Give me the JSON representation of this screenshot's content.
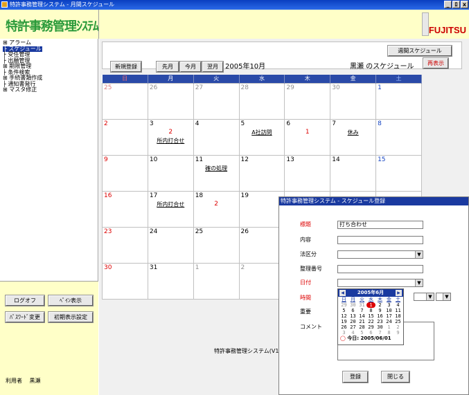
{
  "window": {
    "title": "特許事務管理システム - 月間スケジュール",
    "controls": [
      "_",
      "ﾛ",
      "x"
    ]
  },
  "header": {
    "logo": "特許事務管理ｼｽﾃﾑ",
    "brand": "FUJITSU"
  },
  "sidebar": {
    "tree": [
      "⊞ アラーム",
      "├ スケジュール",
      "├ 受任管理",
      "├ 出願管理",
      "⊞ 期限管理",
      "├ 条件検索",
      "⊞ 手続書類作成",
      "├ 通知書発行",
      "⊞ マスタ修正"
    ],
    "selected_index": 1,
    "buttons": {
      "logoff": "ログオフ",
      "pane": "ﾍﾟｲﾝ表示",
      "password": "ﾊﾟｽﾜｰﾄﾞ変更",
      "initial": "初期表示設定"
    },
    "user_label": "利用者",
    "user_name": "黒瀬"
  },
  "toolbar": {
    "weekly_button": "週間スケジュール",
    "new_button": "新規登録",
    "prev_button": "先月",
    "this_button": "今月",
    "next_button": "翌月",
    "year_month": "2005年10月",
    "schedule_of": "黒瀬 のスケジュール",
    "redisplay_button": "再表示"
  },
  "calendar": {
    "weekdays": [
      "日",
      "月",
      "火",
      "水",
      "木",
      "金",
      "土"
    ],
    "weeks": [
      [
        {
          "d": "25",
          "o": true
        },
        {
          "d": "26",
          "o": true
        },
        {
          "d": "27",
          "o": true
        },
        {
          "d": "28",
          "o": true
        },
        {
          "d": "29",
          "o": true
        },
        {
          "d": "30",
          "o": true
        },
        {
          "d": "1"
        }
      ],
      [
        {
          "d": "2"
        },
        {
          "d": "3",
          "c": "2",
          "e": "所内打合せ"
        },
        {
          "d": "4"
        },
        {
          "d": "5",
          "e": "A社訪問"
        },
        {
          "d": "6",
          "c": "1"
        },
        {
          "d": "7",
          "e": "休み"
        },
        {
          "d": "8"
        }
      ],
      [
        {
          "d": "9"
        },
        {
          "d": "10"
        },
        {
          "d": "11",
          "e": "確の処理"
        },
        {
          "d": "12"
        },
        {
          "d": "13"
        },
        {
          "d": "14"
        },
        {
          "d": "15"
        }
      ],
      [
        {
          "d": "16"
        },
        {
          "d": "17",
          "e": "所内打合せ"
        },
        {
          "d": "18",
          "c": "2"
        },
        {
          "d": "19"
        },
        {
          "d": ""
        },
        {
          "d": ""
        },
        {
          "d": ""
        }
      ],
      [
        {
          "d": "23"
        },
        {
          "d": "24"
        },
        {
          "d": "25"
        },
        {
          "d": "26"
        },
        {
          "d": ""
        },
        {
          "d": ""
        },
        {
          "d": ""
        }
      ],
      [
        {
          "d": "30"
        },
        {
          "d": "31"
        },
        {
          "d": "1",
          "o": true
        },
        {
          "d": "2",
          "o": true
        },
        {
          "d": ""
        },
        {
          "d": ""
        },
        {
          "d": ""
        }
      ]
    ]
  },
  "footer": {
    "system_text": "特許事務管理システム(V1"
  },
  "dialog": {
    "title": "特許事務管理システム - スケジュール登録",
    "labels": {
      "subject": "標題",
      "content": "内容",
      "law": "法区分",
      "ref": "整理番号",
      "date": "日付",
      "time": "時間",
      "importance": "重要",
      "comment": "コメント"
    },
    "subject_value": "打ち合わせ",
    "register_button": "登録",
    "close_button": "閉じる",
    "minical": {
      "title": "2005年6月",
      "dow": [
        "日",
        "月",
        "火",
        "水",
        "木",
        "金",
        "土"
      ],
      "days": [
        [
          "29",
          "o"
        ],
        [
          "30",
          "o"
        ],
        [
          "31",
          "o"
        ],
        [
          "1",
          "t"
        ],
        [
          "2",
          ""
        ],
        [
          "3",
          ""
        ],
        [
          "4",
          ""
        ],
        [
          "5",
          ""
        ],
        [
          "6",
          ""
        ],
        [
          "7",
          ""
        ],
        [
          "8",
          ""
        ],
        [
          "9",
          ""
        ],
        [
          "10",
          ""
        ],
        [
          "11",
          ""
        ],
        [
          "12",
          ""
        ],
        [
          "13",
          ""
        ],
        [
          "14",
          ""
        ],
        [
          "15",
          ""
        ],
        [
          "16",
          ""
        ],
        [
          "17",
          ""
        ],
        [
          "18",
          ""
        ],
        [
          "19",
          ""
        ],
        [
          "20",
          ""
        ],
        [
          "21",
          ""
        ],
        [
          "22",
          ""
        ],
        [
          "23",
          ""
        ],
        [
          "24",
          ""
        ],
        [
          "25",
          ""
        ],
        [
          "26",
          ""
        ],
        [
          "27",
          ""
        ],
        [
          "28",
          ""
        ],
        [
          "29",
          ""
        ],
        [
          "30",
          ""
        ],
        [
          "1",
          "o"
        ],
        [
          "2",
          "o"
        ],
        [
          "3",
          "o"
        ],
        [
          "4",
          "o"
        ],
        [
          "5",
          "o"
        ],
        [
          "6",
          "o"
        ],
        [
          "7",
          "o"
        ],
        [
          "8",
          "o"
        ],
        [
          "9",
          "o"
        ]
      ],
      "today_label": "今日: 2005/06/01"
    }
  }
}
